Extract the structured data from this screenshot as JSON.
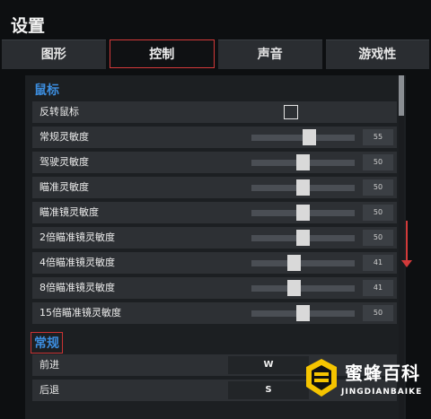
{
  "window": {
    "title": "设置"
  },
  "tabs": [
    {
      "label": "图形",
      "active": false
    },
    {
      "label": "控制",
      "active": true
    },
    {
      "label": "声音",
      "active": false
    },
    {
      "label": "游戏性",
      "active": false
    }
  ],
  "mouse_section": {
    "title": "鼠标",
    "invert": {
      "label": "反转鼠标",
      "checked": false
    },
    "sliders": [
      {
        "label": "常规灵敏度",
        "value": "55"
      },
      {
        "label": "驾驶灵敏度",
        "value": "50"
      },
      {
        "label": "瞄准灵敏度",
        "value": "50"
      },
      {
        "label": "瞄准镜灵敏度",
        "value": "50"
      },
      {
        "label": "2倍瞄准镜灵敏度",
        "value": "50"
      },
      {
        "label": "4倍瞄准镜灵敏度",
        "value": "41"
      },
      {
        "label": "8倍瞄准镜灵敏度",
        "value": "41"
      },
      {
        "label": "15倍瞄准镜灵敏度",
        "value": "50"
      }
    ]
  },
  "general_section": {
    "title": "常规",
    "keys": [
      {
        "label": "前进",
        "key": "W"
      },
      {
        "label": "后退",
        "key": "S"
      }
    ]
  },
  "watermark": {
    "name": "蜜蜂百科",
    "sub": "JINGDIANBAIKE",
    "logo_text": "■■"
  },
  "colors": {
    "accent_blue": "#3c8dde",
    "highlight_red": "#d43a3a",
    "watermark_yellow": "#f5c400"
  }
}
